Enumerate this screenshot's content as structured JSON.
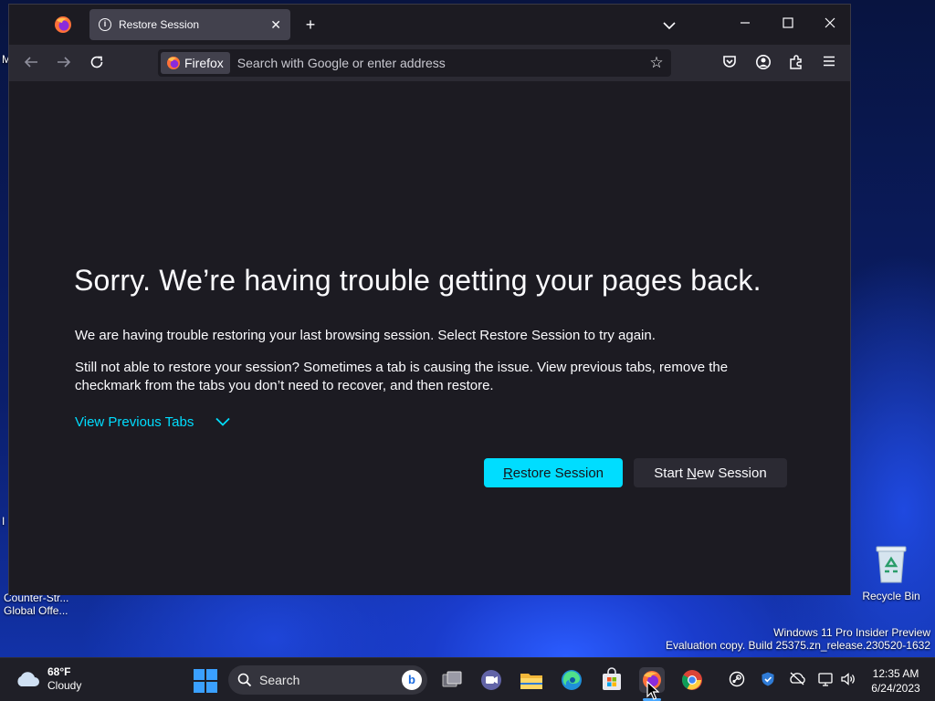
{
  "desktop": {
    "recycle_bin_label": "Recycle Bin",
    "cs_label_line1": "Counter-Str...",
    "cs_label_line2": "Global Offe...",
    "fragment_m": "M",
    "fragment_d": "I",
    "watermark_line1": "Windows 11 Pro Insider Preview",
    "watermark_line2": "Evaluation copy. Build 25375.zn_release.230520-1632"
  },
  "browser": {
    "tab_title": "Restore Session",
    "tab_close": "✕",
    "new_tab": "+",
    "list_tabs": "⌄",
    "minimize": "—",
    "maximize": "☐",
    "close": "✕",
    "identity_label": "Firefox",
    "url_placeholder": "Search with Google or enter address",
    "star": "☆"
  },
  "content": {
    "title": "Sorry. We’re having trouble getting your pages back.",
    "desc1": "We are having trouble restoring your last browsing session. Select Restore Session to try again.",
    "desc2": "Still not able to restore your session? Sometimes a tab is causing the issue. View previous tabs, remove the checkmark from the tabs you don’t need to recover, and then restore.",
    "view_tabs_label": "View Previous Tabs",
    "restore_label_first": "R",
    "restore_label_rest": "estore Session",
    "new_session_pre": "Start ",
    "new_session_key": "N",
    "new_session_post": "ew Session"
  },
  "taskbar": {
    "weather_temp": "68°F",
    "weather_cond": "Cloudy",
    "search_label": "Search",
    "bing": "b",
    "clock_time": "12:35 AM",
    "clock_date": "6/24/2023"
  },
  "colors": {
    "accent": "#00ddff",
    "page_bg": "#1c1b22",
    "toolbar_bg": "#2b2a33"
  }
}
